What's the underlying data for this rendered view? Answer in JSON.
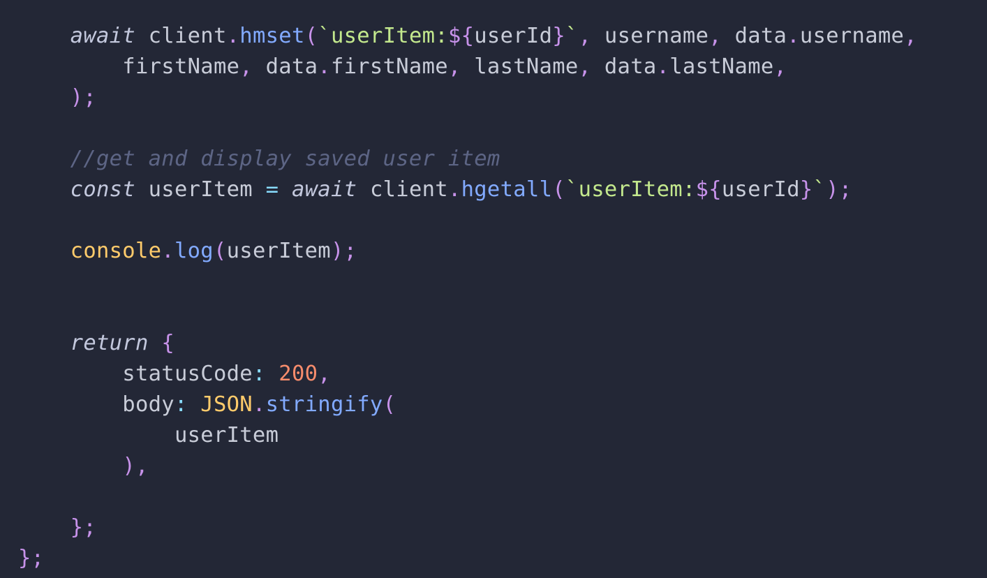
{
  "colors": {
    "background": "#232736",
    "keyword": "#c3c8dd",
    "identifier": "#c8ccd8",
    "function": "#82aaff",
    "string": "#c3e88d",
    "punctuation": "#c792ea",
    "operator": "#89ddff",
    "number": "#f78c6c",
    "object": "#ffcb6b",
    "comment": "#5d6585"
  },
  "lines": [
    [
      {
        "t": "    ",
        "c": "id"
      },
      {
        "t": "await",
        "c": "kw"
      },
      {
        "t": " client",
        "c": "id"
      },
      {
        "t": ".",
        "c": "pun"
      },
      {
        "t": "hmset",
        "c": "fn"
      },
      {
        "t": "(",
        "c": "pun"
      },
      {
        "t": "`",
        "c": "str"
      },
      {
        "t": "userItem:",
        "c": "str"
      },
      {
        "t": "${",
        "c": "pun"
      },
      {
        "t": "userId",
        "c": "id"
      },
      {
        "t": "}",
        "c": "pun"
      },
      {
        "t": "`",
        "c": "str"
      },
      {
        "t": ",",
        "c": "pun"
      },
      {
        "t": " username",
        "c": "id"
      },
      {
        "t": ",",
        "c": "pun"
      },
      {
        "t": " data",
        "c": "id"
      },
      {
        "t": ".",
        "c": "pun"
      },
      {
        "t": "username",
        "c": "id"
      },
      {
        "t": ",",
        "c": "pun"
      }
    ],
    [
      {
        "t": "        firstName",
        "c": "id"
      },
      {
        "t": ",",
        "c": "pun"
      },
      {
        "t": " data",
        "c": "id"
      },
      {
        "t": ".",
        "c": "pun"
      },
      {
        "t": "firstName",
        "c": "id"
      },
      {
        "t": ",",
        "c": "pun"
      },
      {
        "t": " lastName",
        "c": "id"
      },
      {
        "t": ",",
        "c": "pun"
      },
      {
        "t": " data",
        "c": "id"
      },
      {
        "t": ".",
        "c": "pun"
      },
      {
        "t": "lastName",
        "c": "id"
      },
      {
        "t": ",",
        "c": "pun"
      }
    ],
    [
      {
        "t": "    ",
        "c": "id"
      },
      {
        "t": ");",
        "c": "pun"
      }
    ],
    [],
    [
      {
        "t": "    ",
        "c": "id"
      },
      {
        "t": "//get and display saved user item",
        "c": "cmt"
      }
    ],
    [
      {
        "t": "    ",
        "c": "id"
      },
      {
        "t": "const",
        "c": "kw"
      },
      {
        "t": " userItem ",
        "c": "id"
      },
      {
        "t": "=",
        "c": "op"
      },
      {
        "t": " ",
        "c": "id"
      },
      {
        "t": "await",
        "c": "kw"
      },
      {
        "t": " client",
        "c": "id"
      },
      {
        "t": ".",
        "c": "pun"
      },
      {
        "t": "hgetall",
        "c": "fn"
      },
      {
        "t": "(",
        "c": "pun"
      },
      {
        "t": "`",
        "c": "str"
      },
      {
        "t": "userItem:",
        "c": "str"
      },
      {
        "t": "${",
        "c": "pun"
      },
      {
        "t": "userId",
        "c": "id"
      },
      {
        "t": "}",
        "c": "pun"
      },
      {
        "t": "`",
        "c": "str"
      },
      {
        "t": ");",
        "c": "pun"
      }
    ],
    [],
    [
      {
        "t": "    ",
        "c": "id"
      },
      {
        "t": "console",
        "c": "obj"
      },
      {
        "t": ".",
        "c": "pun"
      },
      {
        "t": "log",
        "c": "fn"
      },
      {
        "t": "(",
        "c": "pun"
      },
      {
        "t": "userItem",
        "c": "id"
      },
      {
        "t": ");",
        "c": "pun"
      }
    ],
    [],
    [],
    [
      {
        "t": "    ",
        "c": "id"
      },
      {
        "t": "return",
        "c": "kw"
      },
      {
        "t": " ",
        "c": "id"
      },
      {
        "t": "{",
        "c": "pun"
      }
    ],
    [
      {
        "t": "        statusCode",
        "c": "id"
      },
      {
        "t": ":",
        "c": "op"
      },
      {
        "t": " ",
        "c": "id"
      },
      {
        "t": "200",
        "c": "num"
      },
      {
        "t": ",",
        "c": "pun"
      }
    ],
    [
      {
        "t": "        body",
        "c": "id"
      },
      {
        "t": ":",
        "c": "op"
      },
      {
        "t": " ",
        "c": "id"
      },
      {
        "t": "JSON",
        "c": "obj"
      },
      {
        "t": ".",
        "c": "pun"
      },
      {
        "t": "stringify",
        "c": "fn"
      },
      {
        "t": "(",
        "c": "pun"
      }
    ],
    [
      {
        "t": "            userItem",
        "c": "id"
      }
    ],
    [
      {
        "t": "        ",
        "c": "id"
      },
      {
        "t": "),",
        "c": "pun"
      }
    ],
    [],
    [
      {
        "t": "    ",
        "c": "id"
      },
      {
        "t": "};",
        "c": "pun"
      }
    ],
    [
      {
        "t": "};",
        "c": "pun"
      }
    ]
  ]
}
